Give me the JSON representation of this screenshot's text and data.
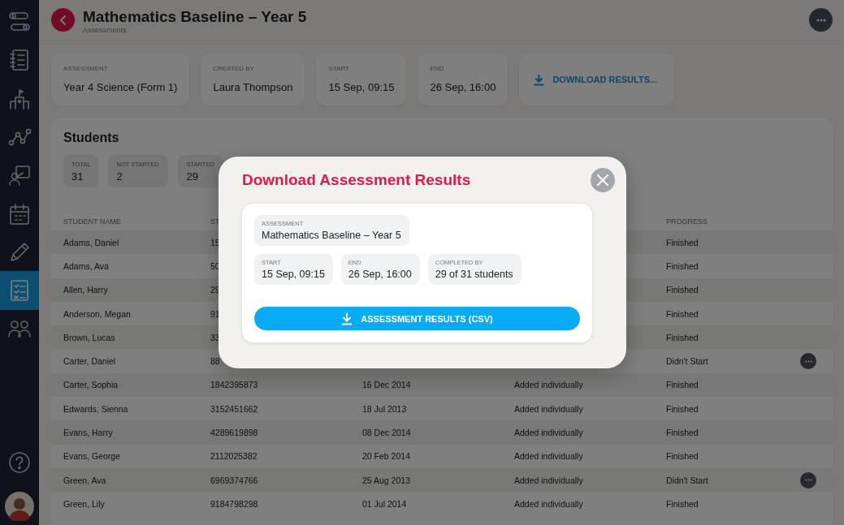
{
  "sidebar": {
    "items": [
      {
        "kind": "route",
        "selected": false
      },
      {
        "kind": "notebook",
        "selected": false
      },
      {
        "kind": "school",
        "selected": false
      },
      {
        "kind": "graph",
        "selected": false
      },
      {
        "kind": "teacher",
        "selected": false
      },
      {
        "kind": "calendar",
        "selected": false
      },
      {
        "kind": "pencil",
        "selected": false
      },
      {
        "kind": "checklist",
        "selected": true
      },
      {
        "kind": "people",
        "selected": false
      }
    ]
  },
  "header": {
    "title": "Mathematics Baseline – Year 5",
    "subtitle": "Assessments"
  },
  "info_cards": [
    {
      "label": "ASSESSMENT",
      "value": "Year 4 Science (Form 1)"
    },
    {
      "label": "CREATED BY",
      "value": "Laura Thompson"
    },
    {
      "label": "START",
      "value": "15 Sep, 09:15"
    },
    {
      "label": "END",
      "value": "26 Sep, 16:00"
    }
  ],
  "download_button": {
    "label": "DOWNLOAD RESULTS..."
  },
  "students": {
    "title": "Students",
    "stats": [
      {
        "label": "TOTAL",
        "value": "31"
      },
      {
        "label": "NOT STARTED",
        "value": "2"
      },
      {
        "label": "STARTED",
        "value": "29"
      }
    ],
    "columns": {
      "column_1": "STUDENT NAME",
      "column_2": "ST",
      "column_5": "PROGRESS"
    },
    "rows": [
      {
        "column_1": "Adams, Daniel",
        "column_2": "15",
        "column_5": "Finished",
        "menu_button": false
      },
      {
        "column_1": "Adams, Ava",
        "column_2": "50",
        "column_5": "Finished",
        "menu_button": false
      },
      {
        "column_1": "Allen, Harry",
        "column_2": "29",
        "column_5": "Finished",
        "menu_button": false
      },
      {
        "column_1": "Anderson, Megan",
        "column_2": "91",
        "column_5": "Finished",
        "menu_button": false
      },
      {
        "column_1": "Brown, Lucas",
        "column_2": "33",
        "column_5": "Finished",
        "menu_button": false
      },
      {
        "column_1": "Carter, Daniel",
        "column_2": "88",
        "column_5": "Didn't Start",
        "menu_button": true
      },
      {
        "column_1": "Carter, Sophia",
        "column_2": "1842395873",
        "column_3": "16 Dec 2014",
        "column_4": "Added individually",
        "column_5": "Finished",
        "menu_button": false
      },
      {
        "column_1": "Edwards, Sienna",
        "column_2": "3152451662",
        "column_3": "18 Jul 2013",
        "column_4": "Added individually",
        "column_5": "Finished",
        "menu_button": false
      },
      {
        "column_1": "Evans, Harry",
        "column_2": "4289619898",
        "column_3": "08 Dec 2014",
        "column_4": "Added individually",
        "column_5": "Finished",
        "menu_button": false
      },
      {
        "column_1": "Evans, George",
        "column_2": "2112025382",
        "column_3": "20 Feb 2014",
        "column_4": "Added individually",
        "column_5": "Finished",
        "menu_button": false
      },
      {
        "column_1": "Green, Ava",
        "column_2": "6969374766",
        "column_3": "25 Aug 2013",
        "column_4": "Added individually",
        "column_5": "Didn't Start",
        "menu_button": true
      },
      {
        "column_1": "Green, Lily",
        "column_2": "9184798298",
        "column_3": "01 Jul 2014",
        "column_4": "Added individually",
        "column_5": "Finished",
        "menu_button": false
      }
    ]
  },
  "modal": {
    "title": "Download Assessment Results",
    "assessment": {
      "label": "ASSESSMENT",
      "value": "Mathematics Baseline – Year 5"
    },
    "details": [
      {
        "label": "START",
        "value": "15 Sep, 09:15"
      },
      {
        "label": "END",
        "value": "26 Sep, 16:00"
      },
      {
        "label": "COMPLETED BY",
        "value": "29 of 31 students"
      }
    ],
    "button": {
      "label": "ASSESSMENT RESULTS (CSV)"
    }
  }
}
